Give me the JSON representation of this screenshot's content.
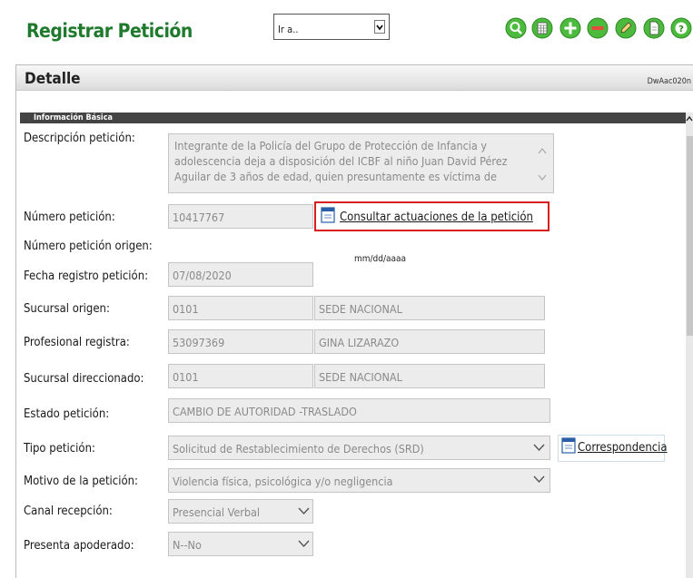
{
  "header": {
    "title": "Registrar Petición",
    "goto": {
      "value": "Ir a.."
    },
    "toolbar_icons": [
      "search-icon",
      "calculator-icon",
      "add-icon",
      "remove-icon",
      "edit-icon",
      "document-icon",
      "help-icon"
    ]
  },
  "detail": {
    "title": "Detalle",
    "code": "DwAac020n",
    "section": "Información Básica"
  },
  "form": {
    "descripcion": {
      "label": "Descripción petición:",
      "value": "Integrante de la Policía del Grupo de Protección de Infancia y adolescencia deja a disposición del ICBF al niño Juan David Pérez Aguilar de 3 años de edad, quien presuntamente es víctima de"
    },
    "numero": {
      "label": "Número petición:",
      "value": "10417767",
      "link": "Consultar actuaciones de la petición"
    },
    "numero_origen": {
      "label": "Número petición origen:"
    },
    "fecha": {
      "label": "Fecha registro petición:",
      "value": "07/08/2020",
      "format": "mm/dd/aaaa"
    },
    "sucursal_origen": {
      "label": "Sucursal origen:",
      "code": "0101",
      "name": "SEDE NACIONAL"
    },
    "profesional": {
      "label": "Profesional registra:",
      "code": "53097369",
      "name": "GINA LIZARAZO"
    },
    "sucursal_dir": {
      "label": "Sucursal direccionado:",
      "code": "0101",
      "name": "SEDE NACIONAL"
    },
    "estado": {
      "label": "Estado petición:",
      "value": "CAMBIO DE AUTORIDAD -TRASLADO"
    },
    "tipo": {
      "label": "Tipo petición:",
      "value": "Solicitud de Restablecimiento de Derechos (SRD)",
      "link": "Correspondencia"
    },
    "motivo": {
      "label": "Motivo de la petición:",
      "value": "Violencia física, psicológica y/o negligencia"
    },
    "canal": {
      "label": "Canal recepción:",
      "value": "Presencial Verbal"
    },
    "apoderado": {
      "label": "Presenta apoderado:",
      "value": "N--No"
    }
  },
  "colors": {
    "title_green": "#1f7a2e",
    "icon_green": "#4cba3c",
    "highlight_red": "#d81e1e"
  }
}
